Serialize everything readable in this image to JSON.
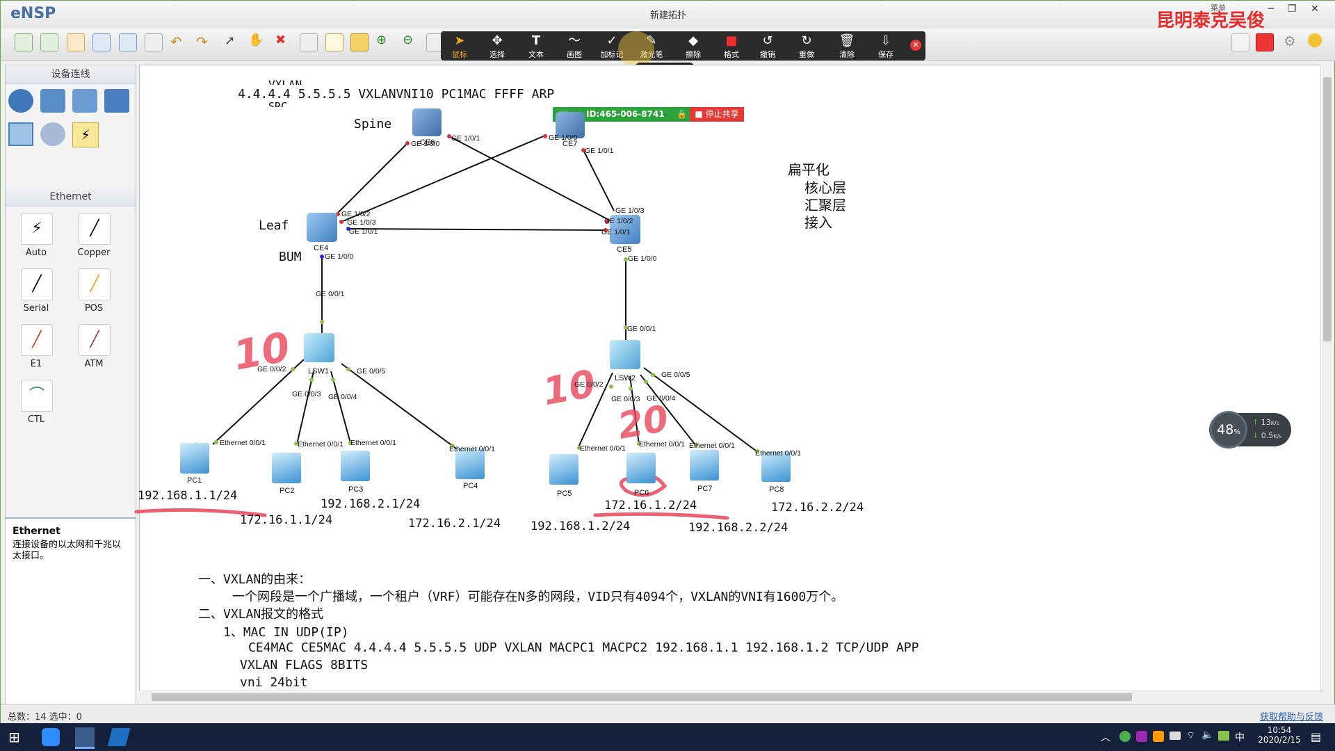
{
  "app": {
    "logo": "eNSP",
    "window_title": "新建拓扑",
    "watermark": "昆明泰克吴俊",
    "menu_hint": "菜单"
  },
  "annotation_toolbar": {
    "items": [
      {
        "icon": "arrow-cursor",
        "label": "鼠标"
      },
      {
        "icon": "move-cross",
        "label": "选择"
      },
      {
        "icon": "text-T",
        "label": "文本"
      },
      {
        "icon": "pen-wave",
        "label": "画图"
      },
      {
        "icon": "check-mark",
        "label": "加标记"
      },
      {
        "icon": "laser-wand",
        "label": "激光笔"
      },
      {
        "icon": "eraser",
        "label": "擦除"
      },
      {
        "icon": "red-square",
        "label": "格式"
      },
      {
        "icon": "undo-arrow",
        "label": "撤销"
      },
      {
        "icon": "redo-arrow",
        "label": "重做"
      },
      {
        "icon": "trash-can",
        "label": "清除"
      },
      {
        "icon": "download-tray",
        "label": "保存"
      }
    ],
    "active_color": "#f5a623"
  },
  "share_bar": {
    "meeting_id": "ID:465-006-8741",
    "stop_label": "■ 停止共享"
  },
  "left_panel": {
    "device_section": "设备连线",
    "cable_section": "Ethernet",
    "cables": [
      "Auto",
      "Copper",
      "Serial",
      "POS",
      "E1",
      "ATM",
      "CTL"
    ],
    "desc_title": "Ethernet",
    "desc_text": "连接设备的以太网和千兆以太接口。"
  },
  "topology": {
    "labels": {
      "spine": "Spine",
      "leaf": "Leaf",
      "bum": "BUM"
    },
    "devices": {
      "ce6": "CE6",
      "ce7": "CE7",
      "ce4": "CE4",
      "ce5": "CE5",
      "lsw1": "LSW1",
      "lsw2": "LSW2",
      "pc1": "PC1",
      "pc2": "PC2",
      "pc3": "PC3",
      "pc4": "PC4",
      "pc5": "PC5",
      "pc6": "PC6",
      "pc7": "PC7",
      "pc8": "PC8"
    },
    "ports": {
      "ce6_100": "GE 1/0/0",
      "ce6_101": "GE 1/0/1",
      "ce7_100": "GE 1/0/0",
      "ce7_101": "GE 1/0/1",
      "ce4_102": "GE 1/0/2",
      "ce4_103": "GE 1/0/3",
      "ce4_101": "GE 1/0/1",
      "ce4_100": "GE 1/0/0",
      "ce5_103": "GE 1/0/3",
      "ce5_102": "GE 1/0/2",
      "ce5_101": "GE 1/0/1",
      "ce5_100": "GE 1/0/0",
      "lsw1_001": "GE 0/0/1",
      "lsw1_002": "GE 0/0/2",
      "lsw1_003": "GE 0/0/3",
      "lsw1_004": "GE 0/0/4",
      "lsw1_005": "GE 0/0/5",
      "lsw2_001": "GE 0/0/1",
      "lsw2_002": "GE 0/0/2",
      "lsw2_003": "GE 0/0/3",
      "lsw2_004": "GE 0/0/4",
      "lsw2_005": "GE 0/0/5",
      "eth": "Ethernet 0/0/1"
    },
    "ips": {
      "pc1": "192.168.1.1/24",
      "pc2": "172.16.1.1/24",
      "pc3": "192.168.2.1/24",
      "pc4": "172.16.2.1/24",
      "pc5": "192.168.1.2/24",
      "pc6": "172.16.1.2/24",
      "pc7": "192.168.2.2/24",
      "pc8": "172.16.2.2/24"
    },
    "handwritten": {
      "left": "10",
      "right": "10",
      "right2": "20"
    },
    "top_text_clipped": "VXLAN",
    "top_text": "4.4.4.4 5.5.5.5 VXLANVNI10 PC1MAC  FFFF ARP",
    "top_text_under": "SRC",
    "flat_notes": [
      "扁平化",
      "核心层",
      "汇聚层",
      "接入"
    ]
  },
  "notes": {
    "line1": "一、VXLAN的由来：",
    "line2": "一个网段是一个广播域，一个租户（VRF）可能存在N多的网段，VID只有4094个，VXLAN的VNI有1600万个。",
    "line3": "二、VXLAN报文的格式",
    "line4": "1、MAC IN UDP(IP)",
    "line5": "CE4MAC CE5MAC 4.4.4.4 5.5.5.5 UDP VXLAN MACPC1 MACPC2 192.168.1.1 192.168.1.2 TCP/UDP APP",
    "line6": "VXLAN FLAGS 8BITS",
    "line7": "vni 24bit"
  },
  "speed_widget": {
    "percent": "48",
    "percent_unit": "%",
    "up": "13",
    "down": "0.5",
    "unit": "K/s"
  },
  "status_bar": {
    "left": "总数：14  选中：0",
    "right": "获取帮助与反馈"
  },
  "taskbar": {
    "time": "10:54",
    "date": "2020/2/15",
    "ime": "中"
  }
}
